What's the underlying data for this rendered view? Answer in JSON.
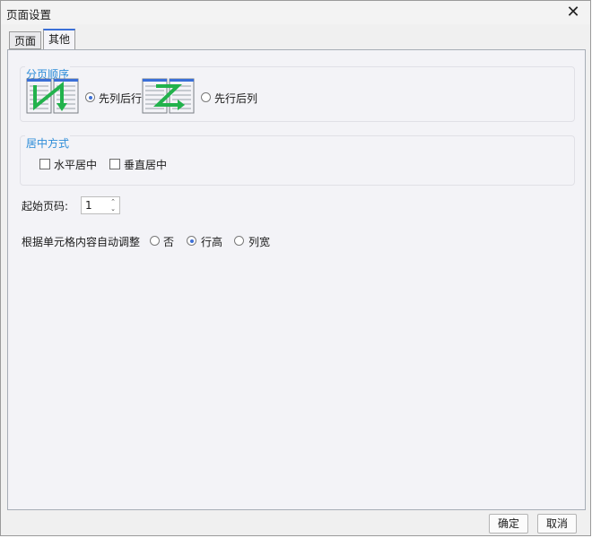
{
  "window": {
    "title": "页面设置",
    "close_symbol": "✕"
  },
  "tabs": [
    {
      "label": "页面",
      "active": false
    },
    {
      "label": "其他",
      "active": true
    }
  ],
  "page_order": {
    "title": "分页顺序",
    "options": [
      {
        "label": "先列后行",
        "selected": true
      },
      {
        "label": "先行后列",
        "selected": false
      }
    ]
  },
  "centering": {
    "title": "居中方式",
    "options": [
      {
        "label": "水平居中",
        "checked": false
      },
      {
        "label": "垂直居中",
        "checked": false
      }
    ]
  },
  "start_page": {
    "label": "起始页码:",
    "value": "1",
    "up": "⌃",
    "down": "⌄"
  },
  "auto_adjust": {
    "label": "根据单元格内容自动调整",
    "options": [
      {
        "label": "否",
        "selected": false
      },
      {
        "label": "行高",
        "selected": true
      },
      {
        "label": "列宽",
        "selected": false
      }
    ]
  },
  "buttons": {
    "ok": "确定",
    "cancel": "取消"
  },
  "colors": {
    "accent": "#2c8cd8",
    "arrow": "#22b24c",
    "page_header": "#3a6fd8"
  }
}
